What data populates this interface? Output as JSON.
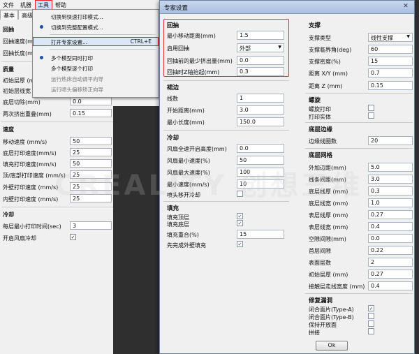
{
  "menubar": {
    "items": [
      "文件",
      "机器",
      "工具",
      "帮助"
    ],
    "active_index": 2
  },
  "tabs": [
    "基本",
    "高级"
  ],
  "dropdown": {
    "items": [
      {
        "label": "切换到快速打印模式...",
        "shortcut": "",
        "dot": false
      },
      {
        "label": "切换到完整配置模式...",
        "shortcut": "",
        "dot": true
      },
      {
        "label": "打开专家设置...",
        "shortcut": "CTRL+E",
        "dot": false
      },
      {
        "label": "多个模型同时打印",
        "shortcut": "",
        "dot": true
      },
      {
        "label": "多个模型逐个打印",
        "shortcut": "",
        "dot": false
      },
      {
        "label": "运行热床自动调平向导",
        "shortcut": "",
        "dot": false
      },
      {
        "label": "运行喷头偏移矫正向导",
        "shortcut": "",
        "dot": false
      }
    ]
  },
  "left": {
    "retraction": {
      "title": "回抽",
      "speed_label": "回抽速度(m",
      "distance_label": "回抽长度(m"
    },
    "quality": {
      "title": "质量",
      "initial_layer_label": "初始层厚 (m",
      "initial_width_label": "初始层线宽",
      "bottom_cut_label": "底层切除(mm)",
      "bottom_cut_value": "0.0",
      "dual_overlap_label": "两次挤出重叠(mm)",
      "dual_overlap_value": "0.15"
    },
    "speed": {
      "title": "速度",
      "rows": [
        {
          "label": "移动速度 (mm/s)",
          "value": "50"
        },
        {
          "label": "底层打印速度(mm/s)",
          "value": "25"
        },
        {
          "label": "填充打印速度(mm/s)",
          "value": "50"
        },
        {
          "label": "顶/底部打印速度 (mm/s)",
          "value": "25"
        },
        {
          "label": "外壁打印速度 (mm/s)",
          "value": "25"
        },
        {
          "label": "内壁打印速度 (mm/s)",
          "value": "25"
        }
      ]
    },
    "cooling": {
      "title": "冷却",
      "min_layer_label": "每层最小打印时间(sec)",
      "min_layer_value": "3",
      "fan_label": "开启风扇冷却",
      "fan_checked": true
    }
  },
  "dialog": {
    "title": "专家设置",
    "close_glyph": "✕",
    "check_glyph": "✓",
    "retraction": {
      "title": "回抽",
      "min_travel_label": "最小移动距离(mm)",
      "min_travel_value": "1.5",
      "combing_label": "启用回抽",
      "combing_value": "外部",
      "min_extrusion_label": "回抽前的最少挤出量(mm)",
      "min_extrusion_value": "0.0",
      "z_hop_label": "回抽时Z轴抬起(mm)",
      "z_hop_value": "0.3"
    },
    "skirt": {
      "title": "裙边",
      "line_count_label": "线数",
      "line_count_value": "1",
      "start_distance_label": "开始距离(mm)",
      "start_distance_value": "3.0",
      "min_length_label": "最小长度(mm)",
      "min_length_value": "150.0"
    },
    "cool": {
      "title": "冷却",
      "fan_full_label": "风扇全速开启高度(mm)",
      "fan_full_value": "0.0",
      "fan_min_label": "风扇最小速度(%)",
      "fan_min_value": "50",
      "fan_max_label": "风扇最大速度(%)",
      "fan_max_value": "100",
      "min_speed_label": "最小速度(mm/s)",
      "min_speed_value": "10",
      "head_lift_label": "喷头移开冷却",
      "head_lift_checked": false
    },
    "infill": {
      "title": "填充",
      "top_label": "填充顶层",
      "top_checked": true,
      "bottom_label": "填充底层",
      "bottom_checked": true,
      "overlap_label": "填充重合(%)",
      "overlap_value": "15",
      "before_wall_label": "先完成外壁填充",
      "before_wall_checked": true
    },
    "support": {
      "title": "支撑",
      "type_label": "支撑类型",
      "type_value": "线性支撑",
      "angle_label": "支撑临界角(deg)",
      "angle_value": "60",
      "fill_label": "支撑密度(%)",
      "fill_value": "15",
      "dist_xy_label": "距离 X/Y (mm)",
      "dist_xy_value": "0.7",
      "dist_z_label": "距离 Z (mm)",
      "dist_z_value": "0.15"
    },
    "spiralize": {
      "title": "螺旋",
      "spiral_label": "螺旋打印",
      "spiral_checked": false,
      "solid_label": "打印实体",
      "solid_checked": false
    },
    "brim": {
      "title": "底层边缘",
      "line_count_label": "边缘线圈数",
      "line_count_value": "20"
    },
    "raft": {
      "title": "底层网格",
      "rows": [
        {
          "label": "外加边距(mm)",
          "value": "5.0"
        },
        {
          "label": "线条间距(mm)",
          "value": "3.0"
        },
        {
          "label": "底层线厚 (mm)",
          "value": "0.3"
        },
        {
          "label": "底层线宽 (mm)",
          "value": "1.0"
        },
        {
          "label": "表层线厚 (mm)",
          "value": "0.27"
        },
        {
          "label": "表层线宽 (mm)",
          "value": "0.4"
        },
        {
          "label": "空隙间隙(mm)",
          "value": "0.0"
        },
        {
          "label": "首层间隙",
          "value": "0.22"
        },
        {
          "label": "表面层数",
          "value": "2"
        },
        {
          "label": "初始层厚 (mm)",
          "value": "0.27"
        },
        {
          "label": "接触层走线宽度 (mm)",
          "value": "0.4"
        }
      ]
    },
    "fix": {
      "title": "修复漏洞",
      "rows": [
        {
          "label": "闭合面片(Type-A)",
          "checked": true
        },
        {
          "label": "闭合面片(Type-B)",
          "checked": false
        },
        {
          "label": "保持开放面",
          "checked": false
        },
        {
          "label": "拼接",
          "checked": false
        }
      ]
    },
    "ok_label": "Ok"
  },
  "watermark": "CREALITY 创想三维"
}
